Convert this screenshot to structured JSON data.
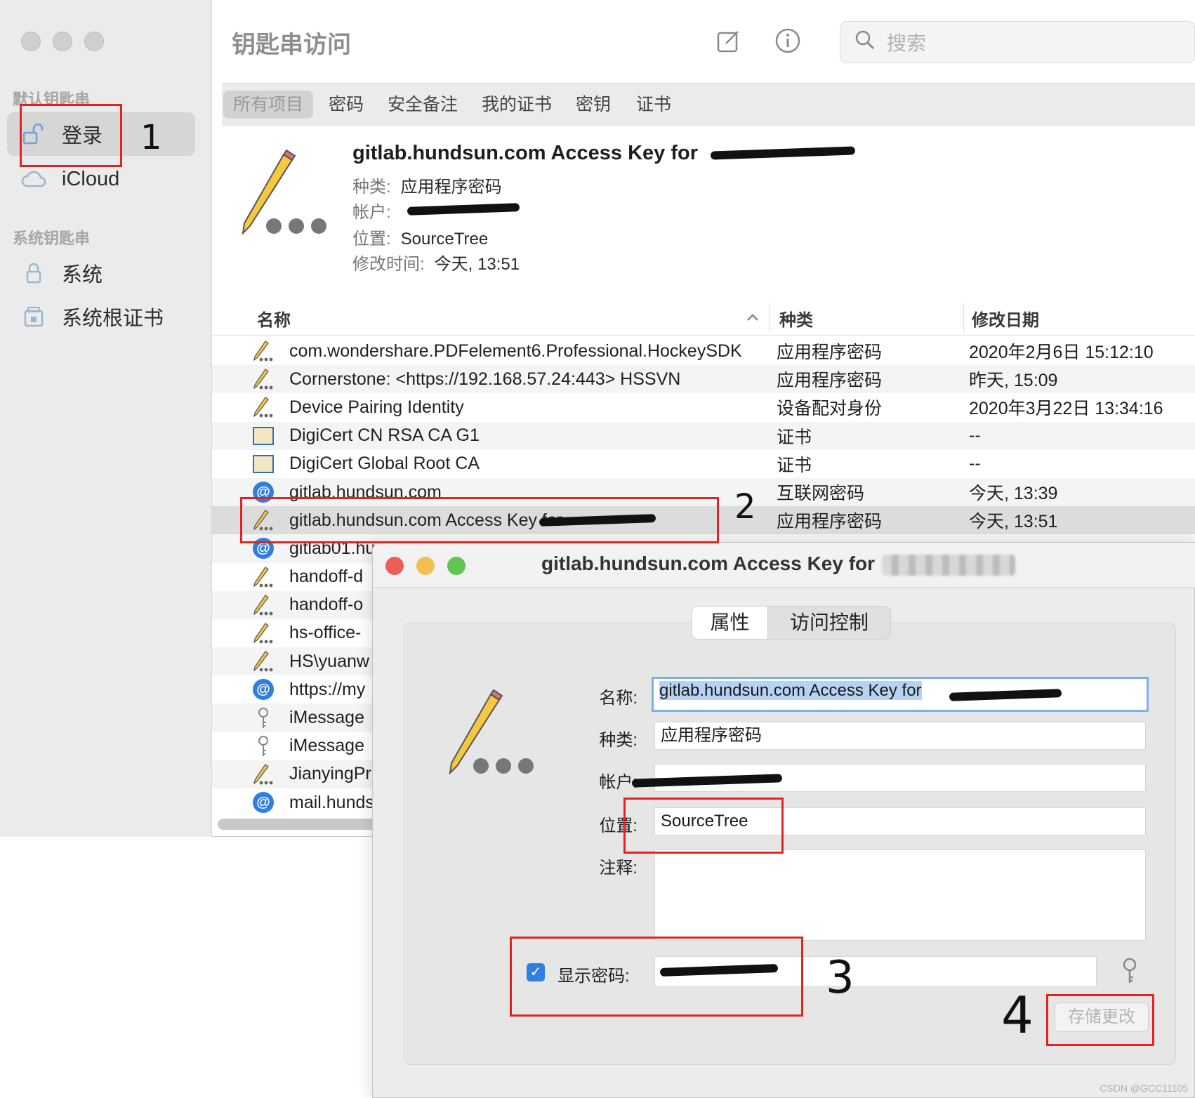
{
  "window": {
    "title": "钥匙串访问",
    "search_placeholder": "搜索"
  },
  "sidebar": {
    "default_header": "默认钥匙串",
    "default_items": [
      {
        "label": "登录",
        "icon": "lock-open-icon"
      },
      {
        "label": "iCloud",
        "icon": "cloud-icon"
      }
    ],
    "system_header": "系统钥匙串",
    "system_items": [
      {
        "label": "系统",
        "icon": "lock-icon"
      },
      {
        "label": "系统根证书",
        "icon": "cabinet-lock-icon"
      }
    ]
  },
  "category_tabs": [
    "所有项目",
    "密码",
    "安全备注",
    "我的证书",
    "密钥",
    "证书"
  ],
  "detail": {
    "title": "gitlab.hundsun.com Access Key for",
    "kind_label": "种类:",
    "kind_value": "应用程序密码",
    "account_label": "帐户:",
    "location_label": "位置:",
    "location_value": "SourceTree",
    "modified_label": "修改时间:",
    "modified_value": "今天, 13:51"
  },
  "columns": {
    "name": "名称",
    "kind": "种类",
    "date": "修改日期"
  },
  "rows": [
    {
      "icon": "pencil-icon",
      "name": "com.wondershare.PDFelement6.Professional.HockeySDK",
      "kind": "应用程序密码",
      "date": "2020年2月6日 15:12:10"
    },
    {
      "icon": "pencil-icon",
      "name": "Cornerstone: <https://192.168.57.24:443> HSSVN",
      "kind": "应用程序密码",
      "date": "昨天, 15:09"
    },
    {
      "icon": "pencil-icon",
      "name": "Device Pairing Identity",
      "kind": "设备配对身份",
      "date": "2020年3月22日 13:34:16"
    },
    {
      "icon": "certificate-icon",
      "name": "DigiCert CN RSA CA G1",
      "kind": "证书",
      "date": "--"
    },
    {
      "icon": "certificate-icon",
      "name": "DigiCert Global Root CA",
      "kind": "证书",
      "date": "--"
    },
    {
      "icon": "at-icon",
      "name": "gitlab.hundsun.com",
      "kind": "互联网密码",
      "date": "今天, 13:39"
    },
    {
      "icon": "pencil-icon",
      "name": "gitlab.hundsun.com Access Key for",
      "kind": "应用程序密码",
      "date": "今天, 13:51"
    },
    {
      "icon": "at-icon",
      "name": "gitlab01.hu",
      "kind": "",
      "date": ""
    },
    {
      "icon": "pencil-icon",
      "name": "handoff-d",
      "kind": "",
      "date": ""
    },
    {
      "icon": "pencil-icon",
      "name": "handoff-o",
      "kind": "",
      "date": ""
    },
    {
      "icon": "pencil-icon",
      "name": "hs-office-",
      "kind": "",
      "date": ""
    },
    {
      "icon": "pencil-icon",
      "name": "HS\\yuanw",
      "kind": "",
      "date": ""
    },
    {
      "icon": "at-icon",
      "name": "https://my",
      "kind": "",
      "date": ""
    },
    {
      "icon": "key-icon",
      "name": "iMessage",
      "kind": "",
      "date": ""
    },
    {
      "icon": "key-icon",
      "name": "iMessage",
      "kind": "",
      "date": ""
    },
    {
      "icon": "pencil-icon",
      "name": "JianyingPr",
      "kind": "",
      "date": ""
    },
    {
      "icon": "at-icon",
      "name": "mail.hunds",
      "kind": "",
      "date": ""
    }
  ],
  "dialog": {
    "title": "gitlab.hundsun.com Access Key for",
    "tab_attributes": "属性",
    "tab_access": "访问控制",
    "name_label": "名称:",
    "name_value": "gitlab.hundsun.com Access Key for",
    "kind_label": "种类:",
    "kind_value": "应用程序密码",
    "account_label": "帐户:",
    "location_label": "位置:",
    "location_value": "SourceTree",
    "notes_label": "注释:",
    "show_password_label": "显示密码:",
    "save_button": "存储更改"
  },
  "annotations": [
    "1",
    "2",
    "3",
    "4"
  ],
  "watermark": "CSDN @GCC11105",
  "colors": {
    "accent": "#2f7fe0",
    "annotation_red": "#e42222",
    "close": "#ec5f57",
    "minimize": "#f4bf4f",
    "zoom": "#61c554"
  }
}
